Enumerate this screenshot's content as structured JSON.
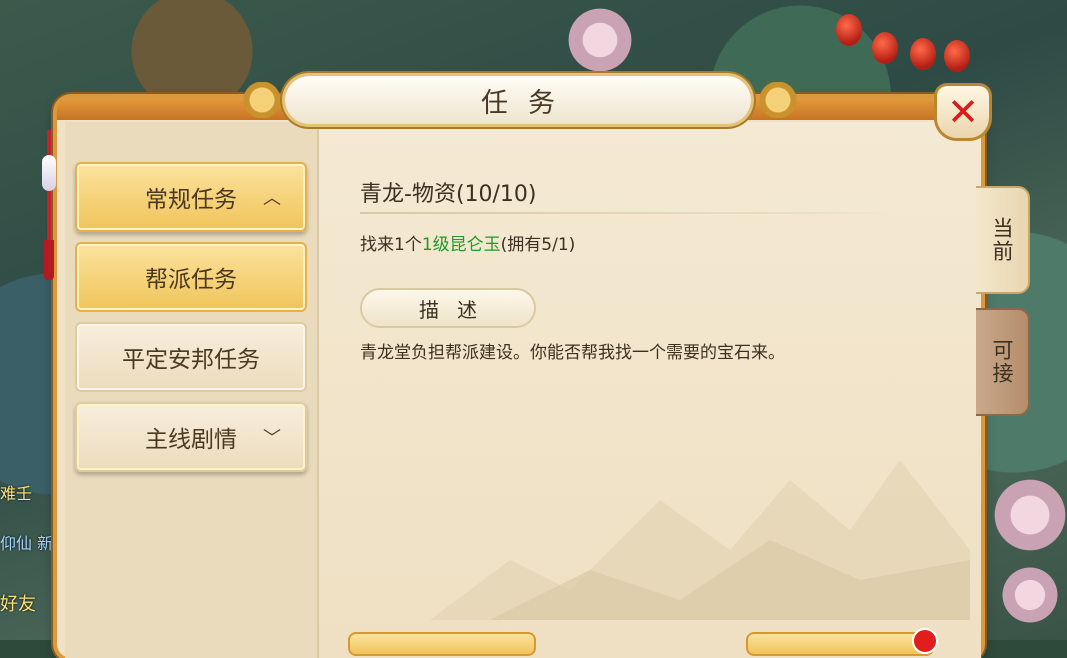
{
  "window": {
    "title": "任务",
    "close_symbol": "✕"
  },
  "sidebar": {
    "items": [
      {
        "label": "常规任务",
        "expanded": true,
        "icon": "chevron-up-icon"
      },
      {
        "label": "帮派任务",
        "selected": true
      },
      {
        "label": "平定安邦任务"
      },
      {
        "label": "主线剧情",
        "expanded": false,
        "icon": "chevron-down-icon"
      }
    ]
  },
  "quest": {
    "name": "青龙-物资(10/10)",
    "objective_prefix": "找来1个",
    "objective_item": "1级昆仑玉",
    "objective_suffix": "(拥有5/1)",
    "desc_label": "描述",
    "description": "青龙堂负担帮派建设。你能否帮我找一个需要的宝石来。"
  },
  "tabs": [
    {
      "label": "当前",
      "active": true
    },
    {
      "label": "可接",
      "active": false
    }
  ],
  "hud": {
    "left_texts": [
      "难壬",
      "仰仙 新",
      "好友"
    ]
  },
  "colors": {
    "accent_gold": "#f0c45a",
    "frame_orange": "#d99a3e",
    "highlight_green": "#1e9a28",
    "close_red": "#d81e1e"
  }
}
